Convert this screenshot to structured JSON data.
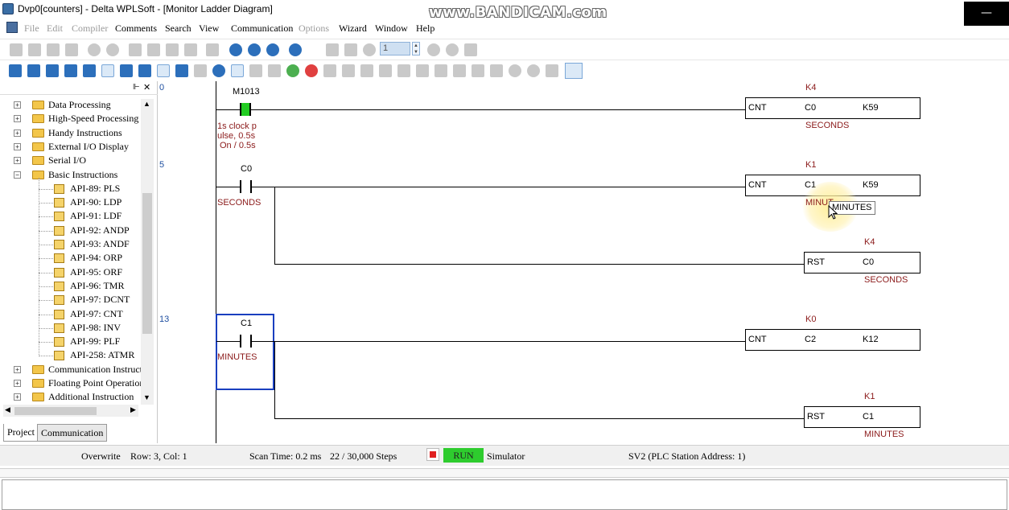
{
  "window": {
    "title": "Dvp0[counters] - Delta WPLSoft - [Monitor Ladder Diagram]",
    "watermark": "www.BANDICAM.com",
    "minimize": "—"
  },
  "menu": [
    "File",
    "Edit",
    "Compiler",
    "Comments",
    "Search",
    "View",
    "Communication",
    "Options",
    "Wizard",
    "Window",
    "Help"
  ],
  "toolbar": {
    "step_value": "1"
  },
  "tree": {
    "items": [
      {
        "label": "Data Processing",
        "expander": "+"
      },
      {
        "label": "High-Speed Processing",
        "expander": "+"
      },
      {
        "label": "Handy Instructions",
        "expander": "+"
      },
      {
        "label": "External I/O Display",
        "expander": "+"
      },
      {
        "label": "Serial I/O",
        "expander": "+"
      },
      {
        "label": "Basic Instructions",
        "expander": "−"
      }
    ],
    "children": [
      "API-89: PLS",
      "API-90: LDP",
      "API-91: LDF",
      "API-92: ANDP",
      "API-93: ANDF",
      "API-94: ORP",
      "API-95: ORF",
      "API-96: TMR",
      "API-97: DCNT",
      "API-97: CNT",
      "API-98: INV",
      "API-99: PLF",
      "API-258: ATMR"
    ],
    "tail": [
      {
        "label": "Communication Instructi",
        "expander": "+"
      },
      {
        "label": "Floating Point Operation",
        "expander": "+"
      },
      {
        "label": "Additional Instruction",
        "expander": "+"
      }
    ]
  },
  "tabs": [
    "Project",
    "Communication"
  ],
  "ladder": {
    "rungs": [
      {
        "number": "0"
      },
      {
        "number": "5"
      },
      {
        "number": "13"
      }
    ],
    "r0": {
      "contact": "M1013",
      "comment": [
        "1s clock p",
        "ulse, 0.5s",
        "On / 0.5s"
      ],
      "inst": "CNT",
      "dev": "C0",
      "k": "K59",
      "preset": "K4",
      "devcomment": "SECONDS"
    },
    "r1": {
      "contact": "C0",
      "contact_comment": "SECONDS",
      "inst": "CNT",
      "dev": "C1",
      "k": "K59",
      "preset": "K1",
      "devcomment": "MINUT",
      "rst": "RST",
      "rst_dev": "C0",
      "rst_preset": "K4",
      "rst_comment": "SECONDS"
    },
    "r2": {
      "contact": "C1",
      "contact_comment": "MINUTES",
      "inst": "CNT",
      "dev": "C2",
      "k": "K12",
      "preset": "K0",
      "rst": "RST",
      "rst_dev": "C1",
      "rst_preset": "K1",
      "rst_comment": "MINUTES"
    },
    "tooltip": "MINUTES"
  },
  "status": {
    "mode": "Overwrite",
    "position": "Row: 3, Col: 1",
    "scan": "Scan Time: 0.2 ms",
    "steps": "22 / 30,000 Steps",
    "run": "RUN",
    "sim": "Simulator",
    "station": "SV2 (PLC Station Address: 1)"
  },
  "colors": {
    "contact_on": "#22cc22",
    "run": "#2ecc2e",
    "stop": "#e02020",
    "rung_num": "#1f4fa0",
    "preset": "#8b1a1a",
    "selection": "#1a3fbf"
  }
}
